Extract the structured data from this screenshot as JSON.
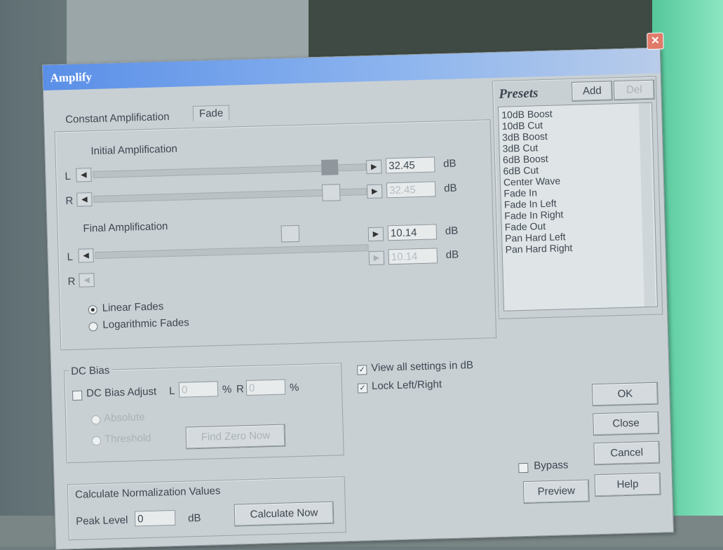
{
  "dialog": {
    "title": "Amplify",
    "close_glyph": "✕",
    "tabs": [
      "Constant Amplification",
      "Fade"
    ],
    "initial": {
      "label": "Initial Amplification",
      "channel_l": "L",
      "channel_r": "R",
      "value_l": "32.45",
      "value_r": "32.45",
      "unit": "dB"
    },
    "final": {
      "label": "Final Amplification",
      "channel_l": "L",
      "channel_r": "R",
      "value_l": "10.14",
      "value_r": "10.14",
      "unit": "dB"
    },
    "fades": {
      "linear": "Linear Fades",
      "log": "Logarithmic Fades"
    },
    "dc_bias": {
      "title": "DC Bias",
      "adjust_label": "DC Bias Adjust",
      "l_label": "L",
      "l_value": "0",
      "r_label": "R",
      "r_value": "0",
      "percent": "%",
      "absolute": "Absolute",
      "threshold": "Threshold",
      "find_zero": "Find Zero Now"
    },
    "options": {
      "view_all_db": "View all settings in dB",
      "lock_lr": "Lock Left/Right"
    },
    "normalize": {
      "title": "Calculate Normalization Values",
      "peak_label": "Peak Level",
      "peak_value": "0",
      "unit": "dB",
      "calculate": "Calculate Now"
    },
    "presets": {
      "title": "Presets",
      "add": "Add",
      "del": "Del",
      "items": [
        "10dB Boost",
        "10dB Cut",
        "3dB Boost",
        "3dB Cut",
        "6dB Boost",
        "6dB Cut",
        "Center Wave",
        "Fade In",
        "Fade In Left",
        "Fade In Right",
        "Fade Out",
        "Pan Hard Left",
        "Pan Hard Right"
      ]
    },
    "buttons": {
      "ok": "OK",
      "close": "Close",
      "cancel": "Cancel",
      "help": "Help",
      "bypass": "Bypass",
      "preview": "Preview"
    }
  }
}
